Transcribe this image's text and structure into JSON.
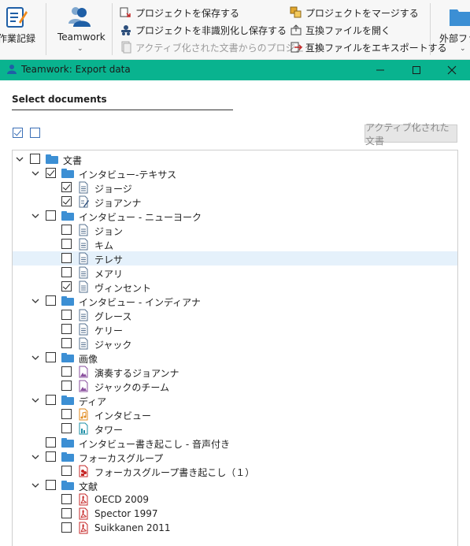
{
  "ribbon": {
    "worklog_label": "作業記録",
    "teamwork_label": "Teamwork",
    "external_label": "外部ファ",
    "save_project": "プロジェクトを保存する",
    "save_anonymized": "プロジェクトを非識別化し保存する",
    "project_from_active": "アクティブ化された文書からのプロジェクト",
    "merge_project": "プロジェクトをマージする",
    "open_exchange": "互換ファイルを開く",
    "export_exchange": "互換ファイルをエキスポートする"
  },
  "window": {
    "title": "Teamwork: Export data"
  },
  "panel": {
    "section_title": "Select documents",
    "activated_docs_button": "アクティブ化された文書"
  },
  "tree": [
    {
      "label": "文書",
      "level": 0,
      "type": "folder",
      "expand": true,
      "checked": false
    },
    {
      "label": "インタビュー-テキサス",
      "level": 1,
      "type": "folder",
      "expand": true,
      "checked": true
    },
    {
      "label": "ジョージ",
      "level": 2,
      "type": "doc",
      "checked": true
    },
    {
      "label": "ジョアンナ",
      "level": 2,
      "type": "doc-edit",
      "checked": true
    },
    {
      "label": "インタビュー - ニューヨーク",
      "level": 1,
      "type": "folder",
      "expand": true,
      "checked": false
    },
    {
      "label": "ジョン",
      "level": 2,
      "type": "doc",
      "checked": false
    },
    {
      "label": "キム",
      "level": 2,
      "type": "doc",
      "checked": false
    },
    {
      "label": "テレサ",
      "level": 2,
      "type": "doc",
      "checked": false,
      "selected": true
    },
    {
      "label": "メアリ",
      "level": 2,
      "type": "doc",
      "checked": false
    },
    {
      "label": "ヴィンセント",
      "level": 2,
      "type": "doc",
      "checked": true
    },
    {
      "label": "インタビュー - インディアナ",
      "level": 1,
      "type": "folder",
      "expand": true,
      "checked": false
    },
    {
      "label": "グレース",
      "level": 2,
      "type": "doc",
      "checked": false
    },
    {
      "label": "ケリー",
      "level": 2,
      "type": "doc",
      "checked": false
    },
    {
      "label": "ジャック",
      "level": 2,
      "type": "doc",
      "checked": false
    },
    {
      "label": "画像",
      "level": 1,
      "type": "folder",
      "expand": true,
      "checked": false
    },
    {
      "label": "演奏するジョアンナ",
      "level": 2,
      "type": "image",
      "checked": false
    },
    {
      "label": "ジャックのチーム",
      "level": 2,
      "type": "image",
      "checked": false
    },
    {
      "label": "ディア",
      "level": 1,
      "type": "folder",
      "expand": true,
      "checked": false
    },
    {
      "label": "インタビュー",
      "level": 2,
      "type": "audio",
      "checked": false
    },
    {
      "label": "タワー",
      "level": 2,
      "type": "video",
      "checked": false
    },
    {
      "label": "インタビュー書き起こし - 音声付き",
      "level": 1,
      "type": "folder",
      "expand": false,
      "checked": false
    },
    {
      "label": "フォーカスグループ",
      "level": 1,
      "type": "folder",
      "expand": true,
      "checked": false
    },
    {
      "label": "フォーカスグループ書き起こし（１）",
      "level": 2,
      "type": "focus",
      "checked": false
    },
    {
      "label": "文献",
      "level": 1,
      "type": "folder",
      "expand": true,
      "checked": false
    },
    {
      "label": "OECD 2009",
      "level": 2,
      "type": "pdf",
      "checked": false
    },
    {
      "label": "Spector 1997",
      "level": 2,
      "type": "pdf",
      "checked": false
    },
    {
      "label": "Suikkanen 2011",
      "level": 2,
      "type": "pdf",
      "checked": false
    }
  ],
  "colors": {
    "titlebar": "#09b38f",
    "folder": "#3c8fd4",
    "selection": "#e5f1fb"
  }
}
